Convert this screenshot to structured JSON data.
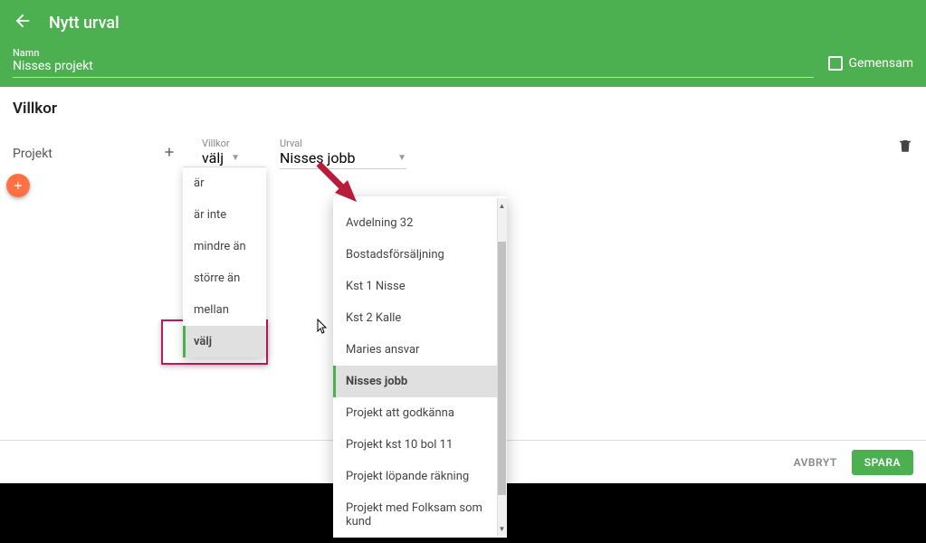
{
  "header": {
    "title": "Nytt urval",
    "name_label": "Namn",
    "name_value": "Nisses projekt",
    "checkbox_label": "Gemensam"
  },
  "section": {
    "title": "Villkor",
    "row_label": "Projekt",
    "villkor_label": "Villkor",
    "villkor_value": "välj",
    "urval_label": "Urval",
    "urval_value": "Nisses jobb"
  },
  "villkor_menu": [
    {
      "label": "är",
      "selected": false
    },
    {
      "label": "är inte",
      "selected": false
    },
    {
      "label": "mindre än",
      "selected": false
    },
    {
      "label": "större än",
      "selected": false
    },
    {
      "label": "mellan",
      "selected": false
    },
    {
      "label": "välj",
      "selected": true
    }
  ],
  "urval_menu": [
    {
      "label": "Avdelning 32",
      "selected": false
    },
    {
      "label": "Bostadsförsäljning",
      "selected": false
    },
    {
      "label": "Kst 1 Nisse",
      "selected": false
    },
    {
      "label": "Kst 2 Kalle",
      "selected": false
    },
    {
      "label": "Maries ansvar",
      "selected": false
    },
    {
      "label": "Nisses jobb",
      "selected": true
    },
    {
      "label": "Projekt att godkänna",
      "selected": false
    },
    {
      "label": "Projekt kst 10 bol 11",
      "selected": false
    },
    {
      "label": "Projekt löpande räkning",
      "selected": false
    },
    {
      "label": "Projekt med Folksam som kund",
      "selected": false
    }
  ],
  "footer": {
    "cancel": "AVBRYT",
    "save": "SPARA"
  }
}
